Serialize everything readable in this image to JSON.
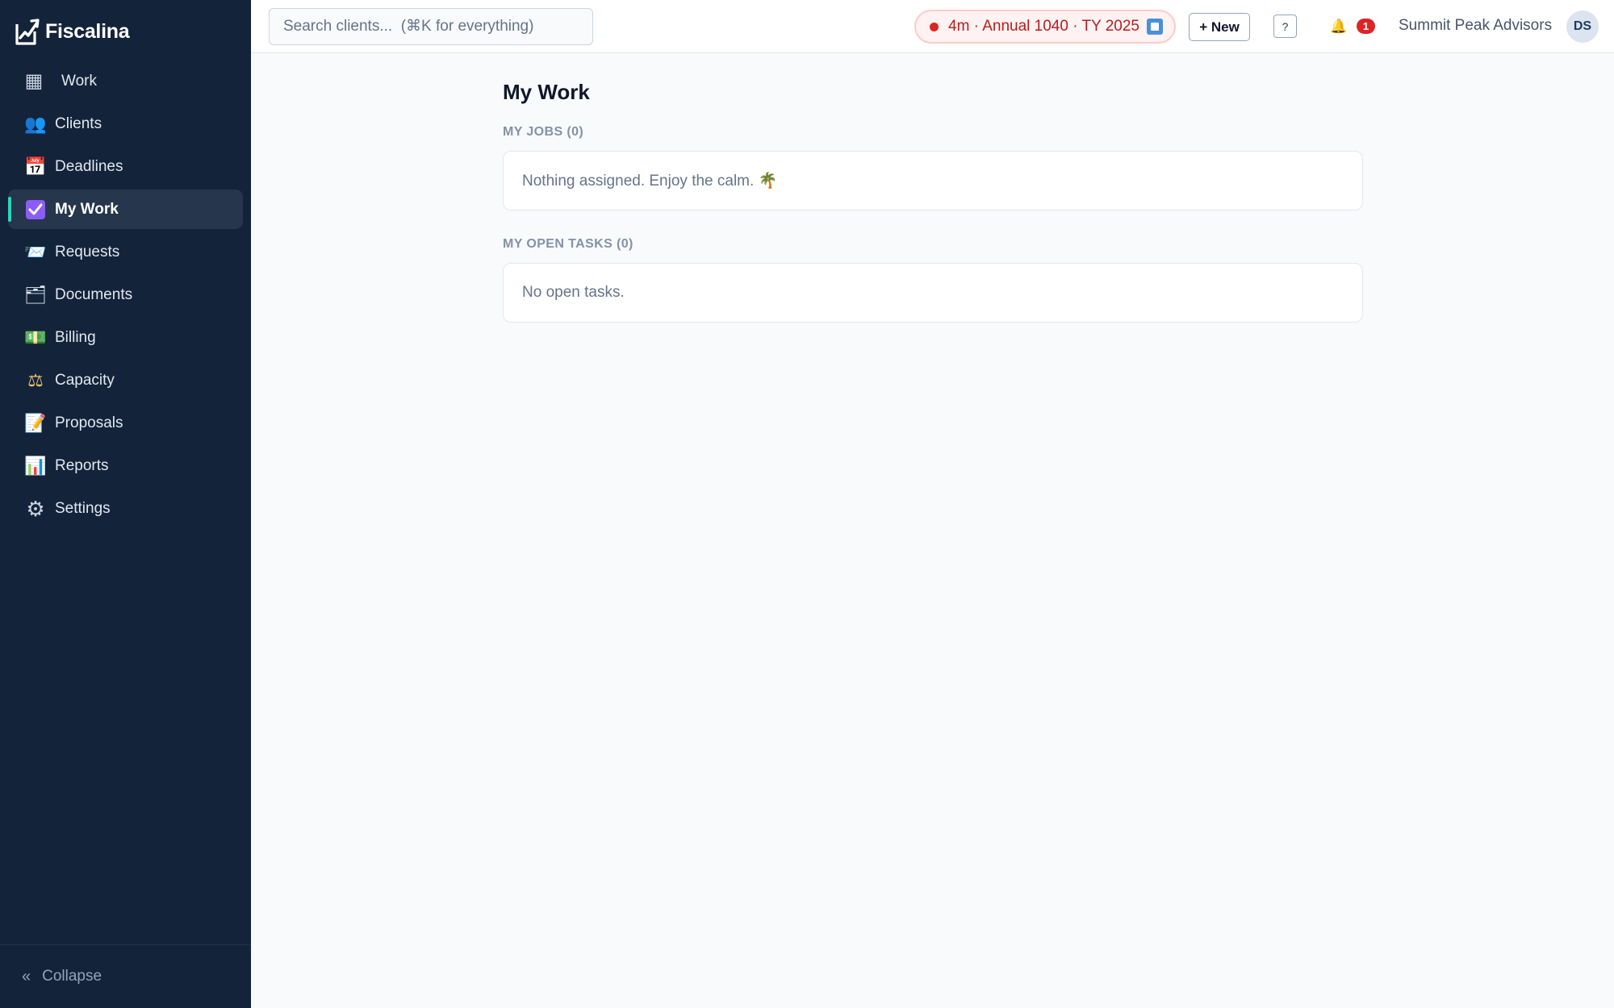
{
  "app": {
    "name": "Fiscalina"
  },
  "sidebar": {
    "items": [
      {
        "label": "Work",
        "icon": "grid-icon",
        "glyph": "▦"
      },
      {
        "label": "Clients",
        "icon": "users-icon",
        "glyph": "👥"
      },
      {
        "label": "Deadlines",
        "icon": "calendar-icon",
        "glyph": "📅"
      },
      {
        "label": "My Work",
        "icon": "checkbox-icon",
        "glyph": "☑",
        "active": true
      },
      {
        "label": "Requests",
        "icon": "inbox-icon",
        "glyph": "📨"
      },
      {
        "label": "Documents",
        "icon": "folder-icon",
        "glyph": "🗂"
      },
      {
        "label": "Billing",
        "icon": "money-icon",
        "glyph": "💵"
      },
      {
        "label": "Capacity",
        "icon": "scales-icon",
        "glyph": "⚖"
      },
      {
        "label": "Proposals",
        "icon": "memo-icon",
        "glyph": "📝"
      },
      {
        "label": "Reports",
        "icon": "bar-chart-icon",
        "glyph": "📊"
      },
      {
        "label": "Settings",
        "icon": "gear-icon",
        "glyph": "⚙"
      }
    ],
    "collapse_label": "Collapse",
    "collapse_glyph": "«"
  },
  "topbar": {
    "search_placeholder": "Search clients...  (⌘K for everything)",
    "timer_label": "4m · Annual 1040 · TY 2025",
    "new_label": "+ New",
    "help_label": "?",
    "bell_glyph": "🔔",
    "notification_count": "1",
    "firm_name": "Summit Peak Advisors",
    "avatar_initials": "DS"
  },
  "main": {
    "title": "My Work",
    "jobs_label": "MY JOBS (0)",
    "jobs_empty": "Nothing assigned. Enjoy the calm. 🌴",
    "tasks_label": "MY OPEN TASKS (0)",
    "tasks_empty": "No open tasks."
  },
  "colors": {
    "sidebar_bg": "#13233a",
    "active_item_bg": "#26364c",
    "active_accent": "#2dd4bf",
    "timer_text": "#b91c1c",
    "badge": "#dc2626"
  }
}
